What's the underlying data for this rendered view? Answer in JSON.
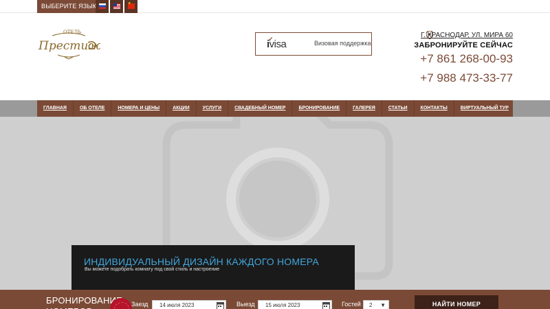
{
  "langbar": {
    "label": "ВЫБЕРИТЕ ЯЗЫК",
    "flags": [
      "russian-flag-icon",
      "us-flag-icon",
      "china-flag-icon"
    ]
  },
  "header": {
    "logo_icon": "hotel-prestige-logo",
    "visa": {
      "logo": "visa",
      "logo_prefix": "i",
      "text": "Визовая поддержка"
    },
    "address": "г. Краснодар, ул. Мира 60",
    "book_now": "ЗАБРОНИРУЙТЕ СЕЙЧАС",
    "phones": [
      "+7 861 268-00-93",
      "+7 988 473-33-77"
    ]
  },
  "nav": {
    "items": [
      "ГЛАВНАЯ",
      "ОБ ОТЕЛЕ",
      "НОМЕРА И ЦЕНЫ",
      "АКЦИИ",
      "УСЛУГИ",
      "СВАДЕБНЫЙ НОМЕР",
      "БРОНИРОВАНИЕ",
      "ГАЛЕРЕЯ",
      "СТАТЬИ",
      "КОНТАКТЫ",
      "ВИРТУАЛЬНЫЙ ТУР"
    ]
  },
  "hero": {
    "placeholder_icon": "camera-icon",
    "title": "ИНДИВИДУАЛЬНЫЙ ДИЗАЙН КАЖДОГО НОМЕРА",
    "subtitle": "Вы можете подобрать комнату под свой стиль и настроение"
  },
  "booking": {
    "title": "БРОНИРОВАНИЕ НОМЕРОВ",
    "checkin_label": "Заезд",
    "checkin_value": "14 июля 2023",
    "checkout_label": "Выезд",
    "checkout_value": "15 июля 2023",
    "guests_label": "Гостей",
    "guests_value": "2",
    "find_button": "НАЙТИ НОМЕР"
  },
  "colors": {
    "brand": "#7b4a36",
    "accent_blue": "#42a6dc",
    "dark_button": "#3c2219"
  }
}
